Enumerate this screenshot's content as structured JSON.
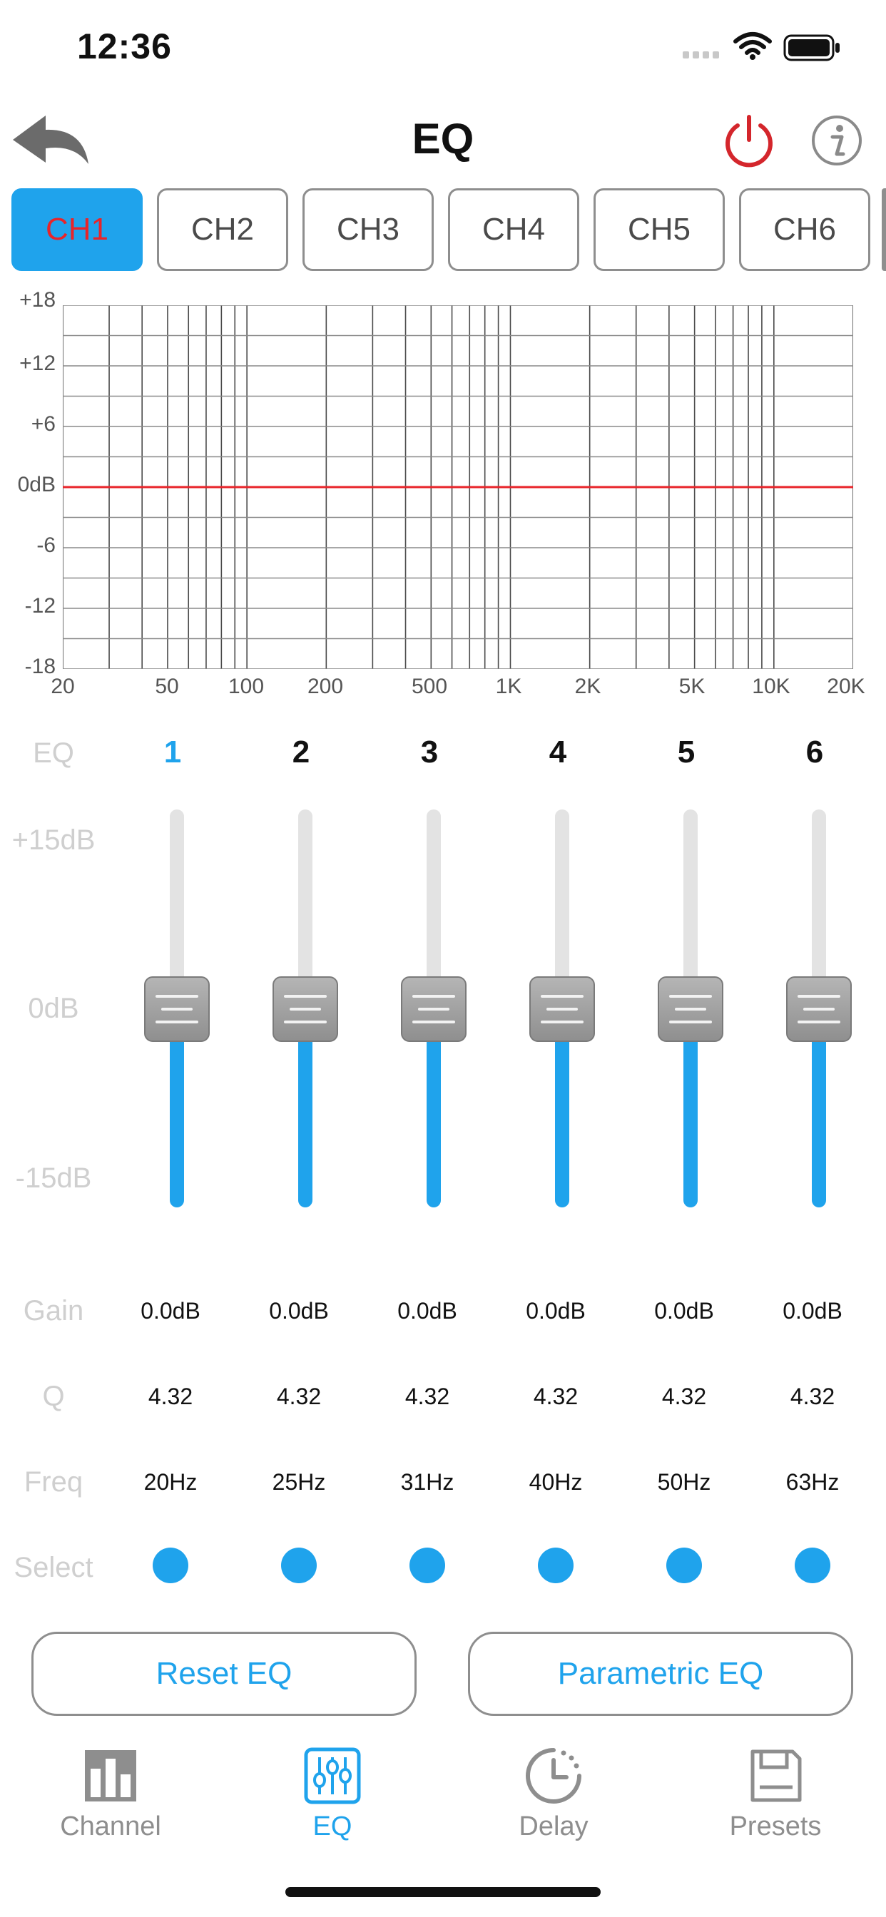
{
  "status": {
    "time": "12:36"
  },
  "nav": {
    "title": "EQ"
  },
  "channels": [
    "CH1",
    "CH2",
    "CH3",
    "CH4",
    "CH5",
    "CH6"
  ],
  "active_channel": "CH1",
  "graph": {
    "y_ticks": [
      "+18",
      "+12",
      "+6",
      "0dB",
      "-6",
      "-12",
      "-18"
    ],
    "x_ticks": [
      "20",
      "50",
      "100",
      "200",
      "500",
      "1K",
      "2K",
      "5K",
      "10K",
      "20K"
    ],
    "curve_color": "#e8242a",
    "curve_gain_db": 0
  },
  "bands": {
    "header_label": "EQ",
    "numbers": [
      "1",
      "2",
      "3",
      "4",
      "5",
      "6"
    ],
    "active_band": "1",
    "scale": {
      "top": "+15dB",
      "mid": "0dB",
      "bottom": "-15dB"
    },
    "gain_label": "Gain",
    "q_label": "Q",
    "freq_label": "Freq",
    "select_label": "Select",
    "gains": [
      "0.0dB",
      "0.0dB",
      "0.0dB",
      "0.0dB",
      "0.0dB",
      "0.0dB"
    ],
    "q_values": [
      "4.32",
      "4.32",
      "4.32",
      "4.32",
      "4.32",
      "4.32"
    ],
    "freqs": [
      "20Hz",
      "25Hz",
      "31Hz",
      "40Hz",
      "50Hz",
      "63Hz"
    ],
    "slider_levels_db": [
      0,
      0,
      0,
      0,
      0,
      0
    ]
  },
  "buttons": {
    "reset": "Reset EQ",
    "parametric": "Parametric EQ"
  },
  "tabbar": {
    "items": [
      {
        "label": "Channel",
        "icon": "bar-chart-icon"
      },
      {
        "label": "EQ",
        "icon": "equalizer-sliders-icon"
      },
      {
        "label": "Delay",
        "icon": "clock-icon"
      },
      {
        "label": "Presets",
        "icon": "save-icon"
      }
    ],
    "active": "EQ"
  },
  "colors": {
    "accent": "#1fa3ec",
    "active_text": "#e8242a",
    "power": "#d4262c"
  }
}
